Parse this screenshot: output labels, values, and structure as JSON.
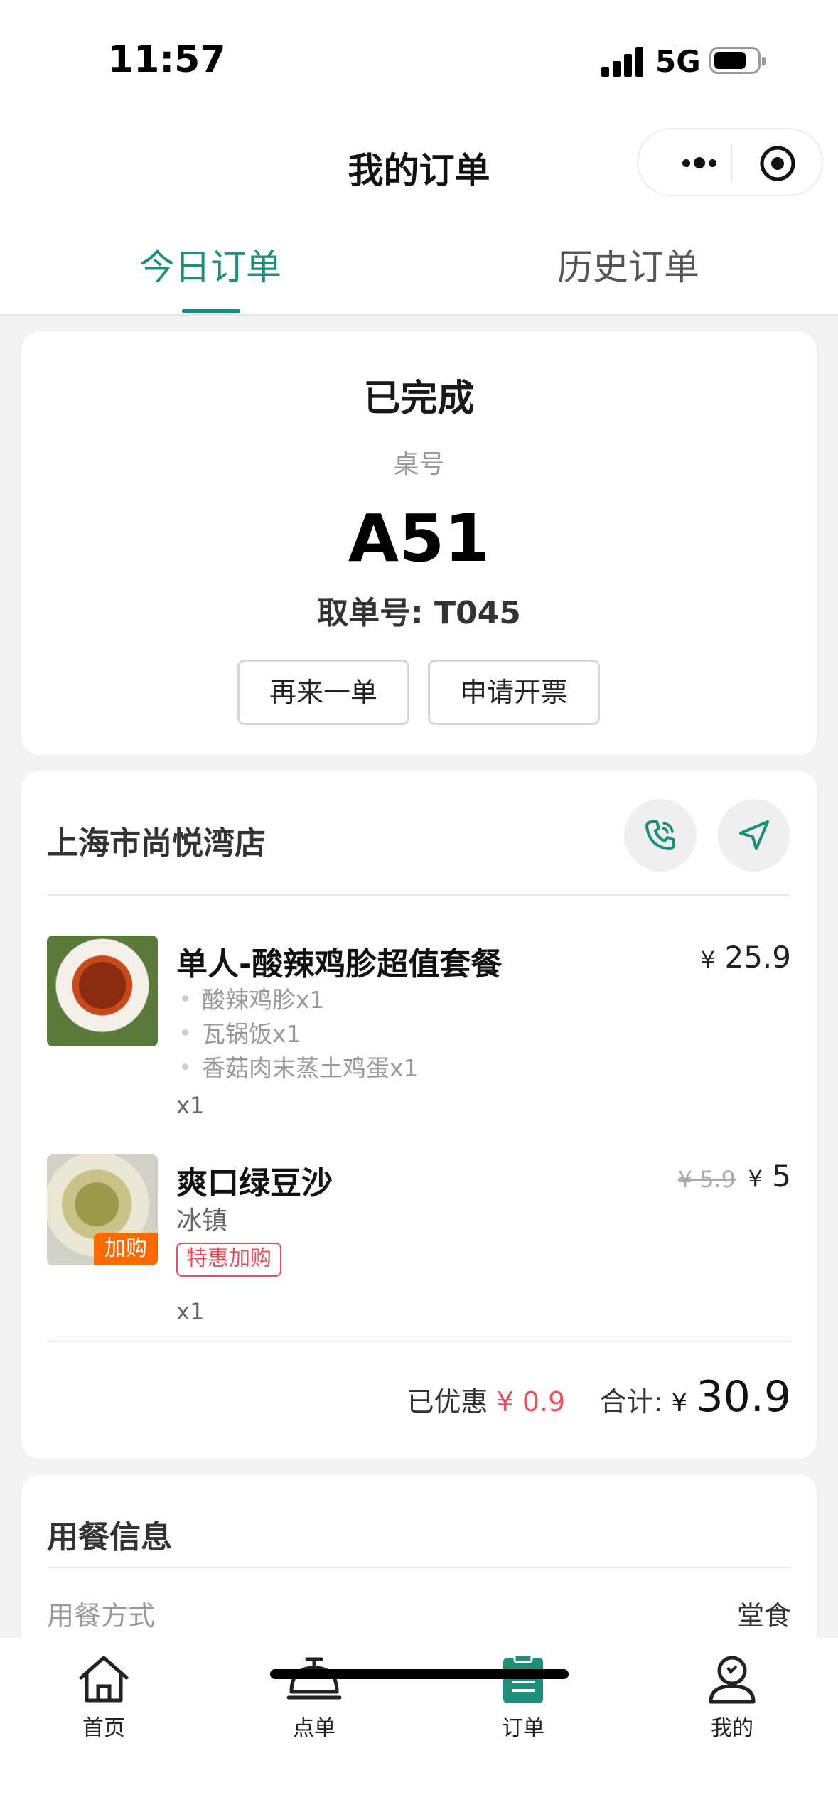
{
  "status_bar": {
    "time": "11:57",
    "network": "5G"
  },
  "header": {
    "title": "我的订单"
  },
  "tabs": [
    {
      "label": "今日订单",
      "active": true
    },
    {
      "label": "历史订单",
      "active": false
    }
  ],
  "order_status": {
    "status": "已完成",
    "table_label": "桌号",
    "table_number": "A51",
    "pickup_number": "取单号: T045",
    "buttons": {
      "reorder": "再来一单",
      "invoice": "申请开票"
    }
  },
  "order": {
    "store_name": "上海市尚悦湾店",
    "items": [
      {
        "name": "单人-酸辣鸡胗超值套餐",
        "currency": "¥",
        "price": "25.9",
        "components": [
          "酸辣鸡胗x1",
          "瓦锅饭x1",
          "香菇肉末蒸土鸡蛋x1"
        ],
        "quantity": "x1"
      },
      {
        "name": "爽口绿豆沙",
        "thumb_tag": "加购",
        "note": "冰镇",
        "promo_tag": "特惠加购",
        "original_price": "¥ 5.9",
        "currency": "¥",
        "price": "5",
        "quantity": "x1"
      }
    ],
    "summary": {
      "discount_label": "已优惠",
      "discount_value": "¥ 0.9",
      "total_label": "合计:",
      "currency": "¥",
      "total_value": "30.9"
    }
  },
  "dining_info": {
    "title": "用餐信息",
    "method_label": "用餐方式",
    "method_value": "堂食"
  },
  "tabbar": {
    "items": [
      {
        "label": "首页",
        "icon": "home-icon"
      },
      {
        "label": "点单",
        "icon": "cloche-icon"
      },
      {
        "label": "订单",
        "icon": "order-list-icon",
        "active": true
      },
      {
        "label": "我的",
        "icon": "profile-icon"
      }
    ]
  },
  "colors": {
    "accent": "#1e8e78",
    "discount": "#e8505b",
    "addon_tag": "#ff6a00"
  }
}
